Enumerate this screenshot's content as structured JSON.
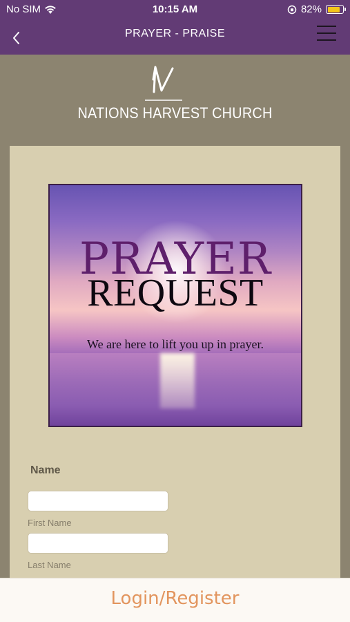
{
  "status_bar": {
    "carrier": "No SIM",
    "time": "10:15 AM",
    "battery_percent": "82%",
    "battery_level": 0.82,
    "battery_color": "#f3c51a"
  },
  "nav": {
    "title": "PRAYER - PRAISE",
    "back_icon": "chevron-left-icon",
    "menu_icon": "hamburger-menu-icon"
  },
  "brand": {
    "name": "NATIONS HARVEST CHURCH",
    "logo": "N"
  },
  "banner": {
    "title_line1": "PRAYER",
    "title_line2": "REQUEST",
    "tagline": "We are here to lift you up in prayer."
  },
  "form": {
    "name_label": "Name",
    "first_name": {
      "value": "",
      "caption": "First Name"
    },
    "last_name": {
      "value": "",
      "caption": "Last Name"
    }
  },
  "bottom": {
    "login_label": "Login/Register"
  },
  "colors": {
    "nav_bg": "#623b75",
    "page_bg": "#8c8470",
    "panel_bg": "#d8cfb0",
    "login_accent": "#e2955e"
  }
}
